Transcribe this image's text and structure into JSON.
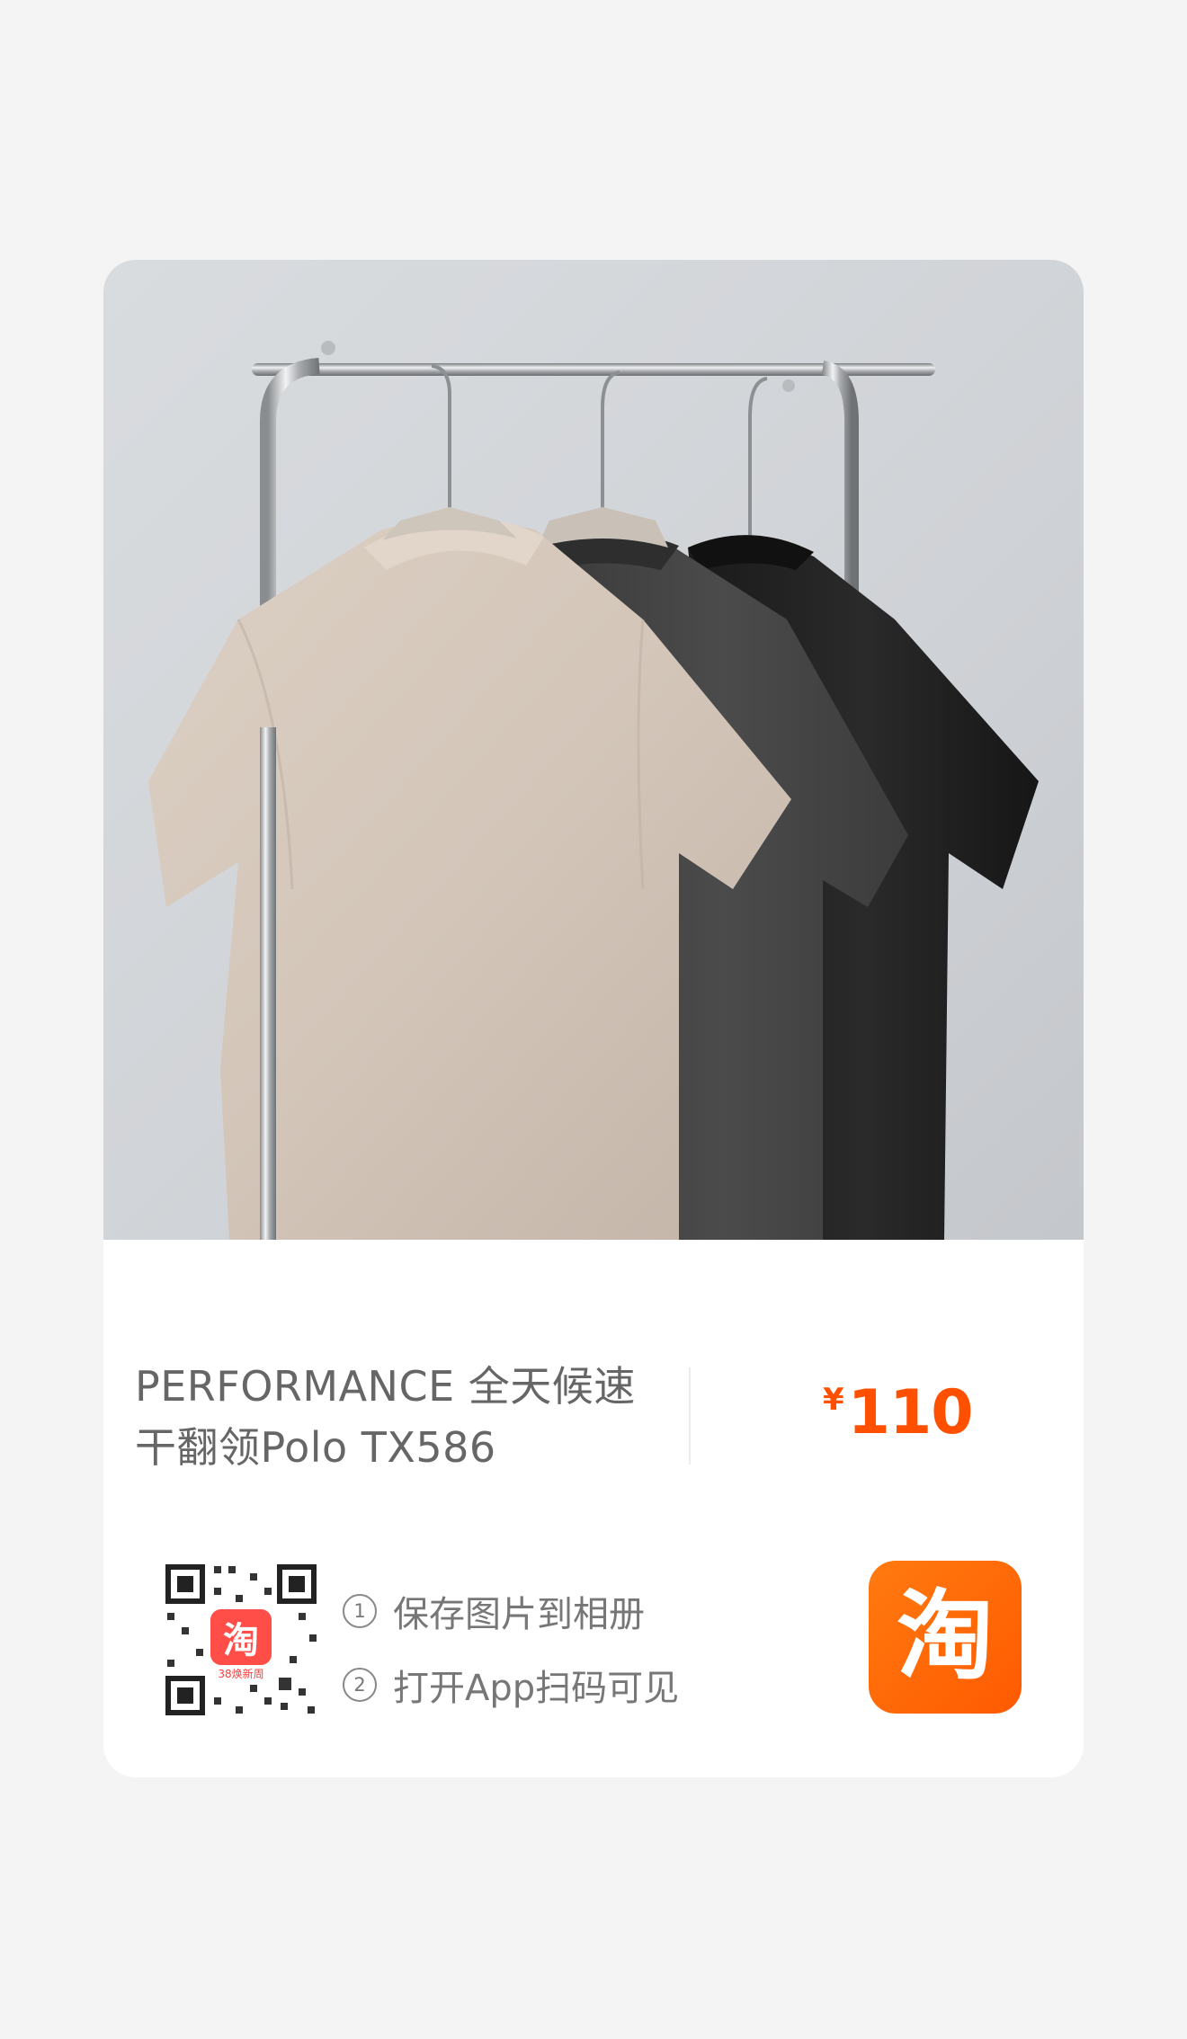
{
  "product": {
    "title_line1": "PERFORMANCE 全天候速",
    "title_line2": "干翻领Polo TX586",
    "currency_symbol": "¥",
    "price": "110",
    "image_description_icon": "product-photo-polo-shirts"
  },
  "share": {
    "steps": [
      {
        "number": "1",
        "text": "保存图片到相册"
      },
      {
        "number": "2",
        "text": "打开App扫码可见"
      }
    ],
    "qr_badge_char": "淘",
    "qr_badge_caption": "38焕新周",
    "logo_char": "淘"
  },
  "colors": {
    "page_bg": "#f4f4f4",
    "card_bg": "#ffffff",
    "price": "#ff5000",
    "brand_orange": "#ff6a00",
    "title_text": "#666666"
  }
}
